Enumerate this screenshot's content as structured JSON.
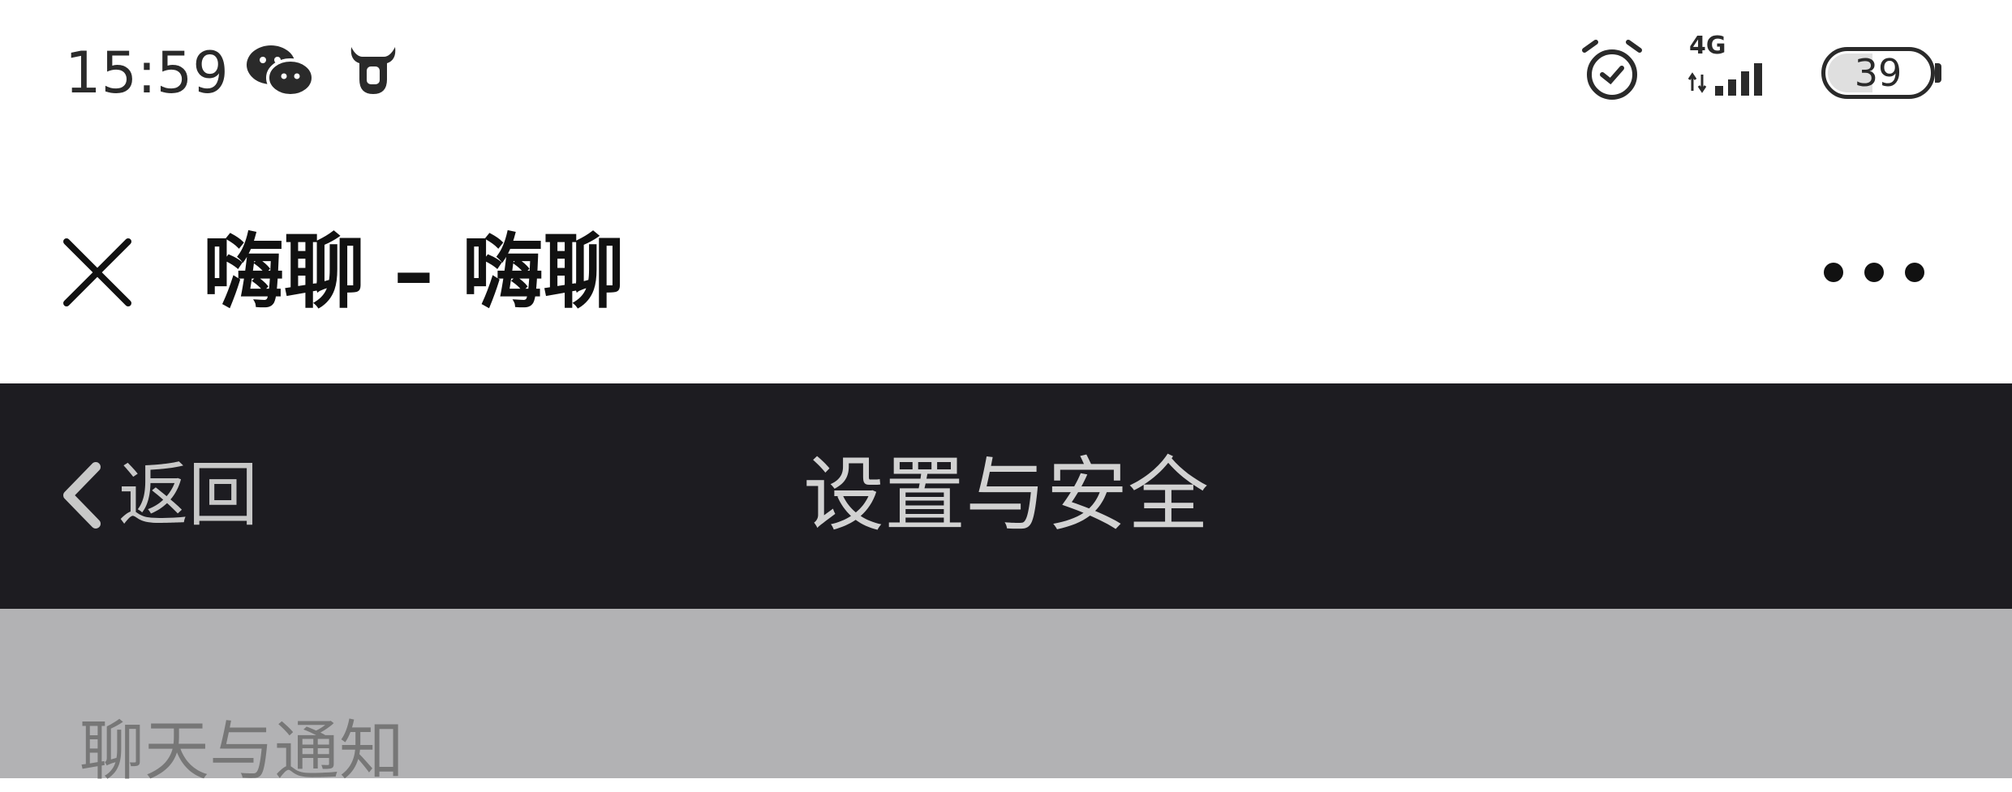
{
  "status_bar": {
    "time": "15:59",
    "network": "4G",
    "battery": "39",
    "icons": [
      "wechat-icon",
      "bull-head-icon",
      "alarm-clock-icon",
      "signal-icon",
      "battery-icon"
    ]
  },
  "title_bar": {
    "title": "嗨聊 – 嗨聊",
    "close_icon": "close-icon",
    "more_icon": "more-icon"
  },
  "header": {
    "back_label": "返回",
    "title": "设置与安全",
    "background_color": "#1d1c21"
  },
  "section": {
    "title": "聊天与通知"
  }
}
